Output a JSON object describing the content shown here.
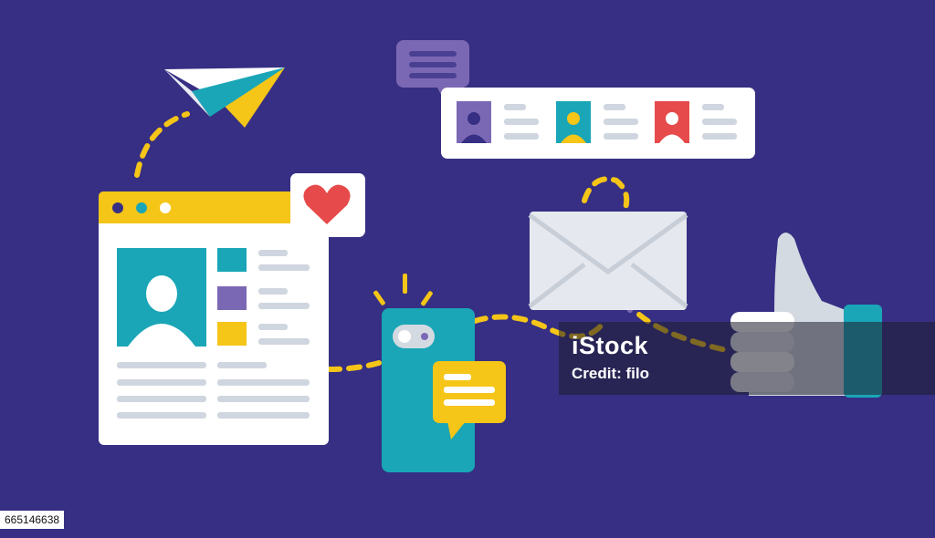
{
  "watermark": {
    "logo": "iStock",
    "credit": "Credit: filo"
  },
  "stock_id": "665146638",
  "icons": [
    "paper-plane-icon",
    "speech-bubble-icon",
    "heart-icon",
    "user-avatar-icon",
    "envelope-icon",
    "smartphone-icon",
    "chat-bubble-icon",
    "thumbs-up-icon"
  ],
  "colors": {
    "background": "#362f83",
    "teal": "#1aa6b7",
    "yellow": "#f5c518",
    "purple": "#7b68b5",
    "red": "#e64a4a",
    "white": "#ffffff",
    "gray": "#d4dae2"
  }
}
